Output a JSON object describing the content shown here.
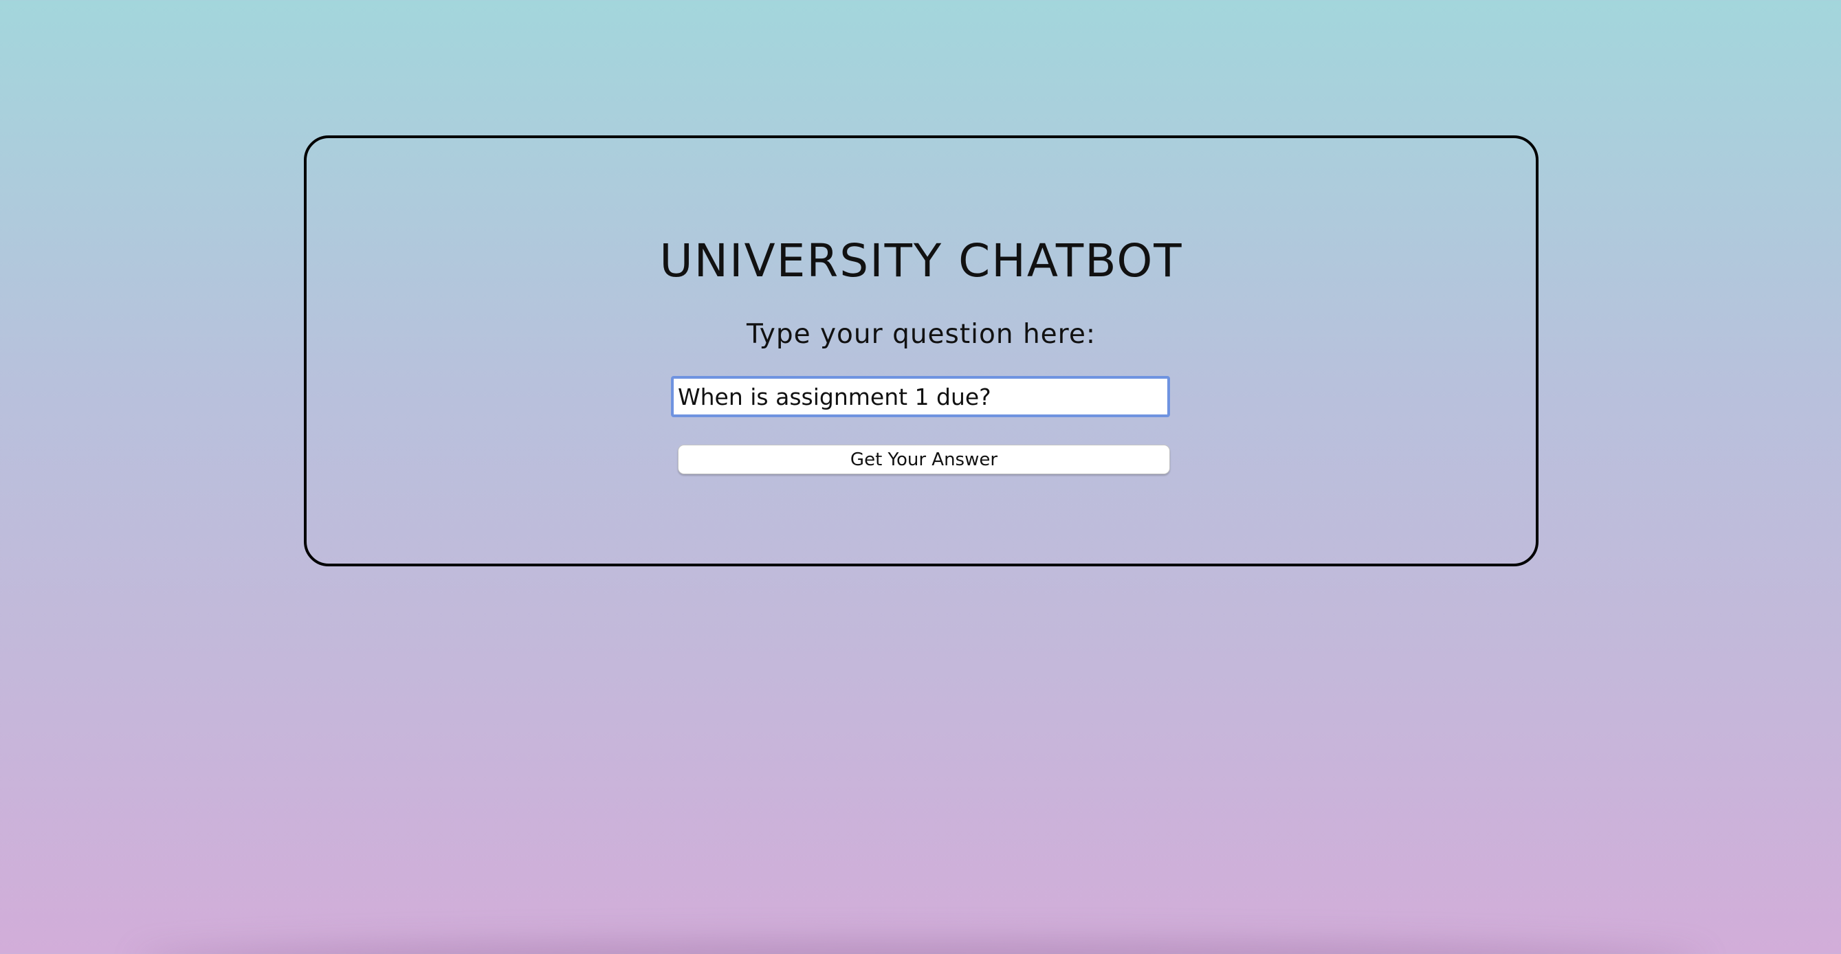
{
  "card": {
    "title": "UNIVERSITY CHATBOT",
    "prompt": "Type your question here:",
    "input": {
      "value": "When is assignment 1 due?",
      "placeholder": ""
    },
    "submit_label": "Get Your Answer"
  },
  "colors": {
    "gradient_top": "#a3d6dc",
    "gradient_bottom": "#d2add9",
    "card_border": "#000000",
    "input_focus_border": "#6f93e0"
  }
}
